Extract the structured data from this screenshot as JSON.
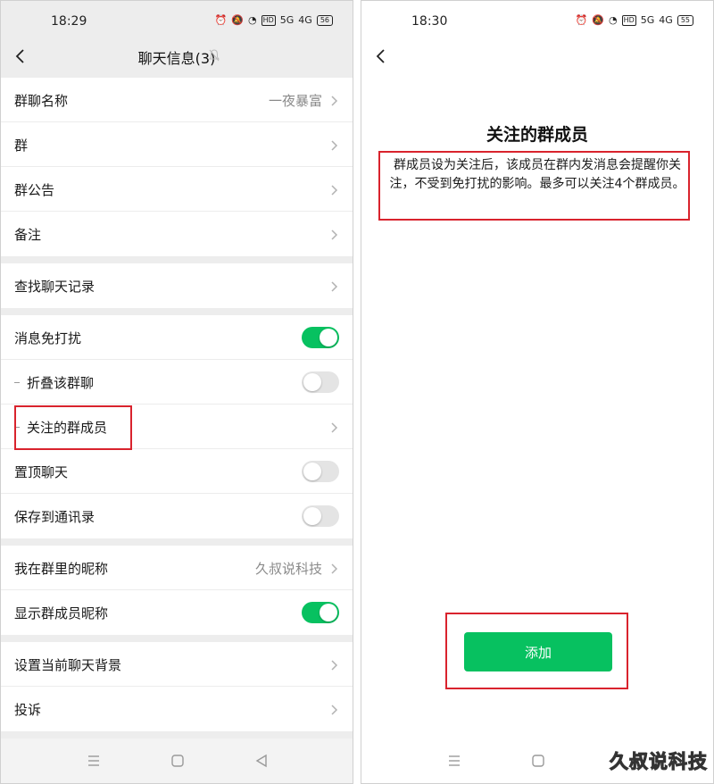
{
  "left_screen": {
    "status": {
      "time": "18:29",
      "network": "5G",
      "network2": "4G",
      "hd": "HD",
      "battery": "56"
    },
    "nav": {
      "title": "聊天信息(3)"
    },
    "groups": [
      [
        {
          "label": "群聊名称",
          "value": "一夜暴富"
        },
        {
          "label": "群",
          "value": ""
        },
        {
          "label": "群公告",
          "value": ""
        },
        {
          "label": "备注",
          "value": ""
        }
      ],
      [
        {
          "label": "查找聊天记录",
          "value": ""
        }
      ],
      [
        {
          "label": "消息免打扰",
          "toggle": true
        },
        {
          "label": "折叠该群聊",
          "toggle": false
        },
        {
          "label": "关注的群成员",
          "value": ""
        },
        {
          "label": "置顶聊天",
          "toggle": false
        },
        {
          "label": "保存到通讯录",
          "toggle": false
        }
      ],
      [
        {
          "label": "我在群里的昵称",
          "value": "久叔说科技"
        },
        {
          "label": "显示群成员昵称",
          "toggle": true
        }
      ],
      [
        {
          "label": "设置当前聊天背景",
          "value": ""
        },
        {
          "label": "投诉",
          "value": ""
        }
      ]
    ]
  },
  "right_screen": {
    "status": {
      "time": "18:30",
      "network": "5G",
      "network2": "4G",
      "hd": "HD",
      "battery": "55"
    },
    "title": "关注的群成员",
    "description": "群成员设为关注后，该成员在群内发消息会提醒你关注，不受到免打扰的影响。最多可以关注4个群成员。",
    "add_button": "添加"
  },
  "watermark": "久叔说科技",
  "colors": {
    "accent": "#07c160",
    "highlight": "#d9232d",
    "background": "#ededed"
  },
  "icons": [
    "back-arrow-icon",
    "bell-muted-icon",
    "chevron-right-icon",
    "menu-icon",
    "home-square-icon",
    "back-triangle-icon"
  ]
}
